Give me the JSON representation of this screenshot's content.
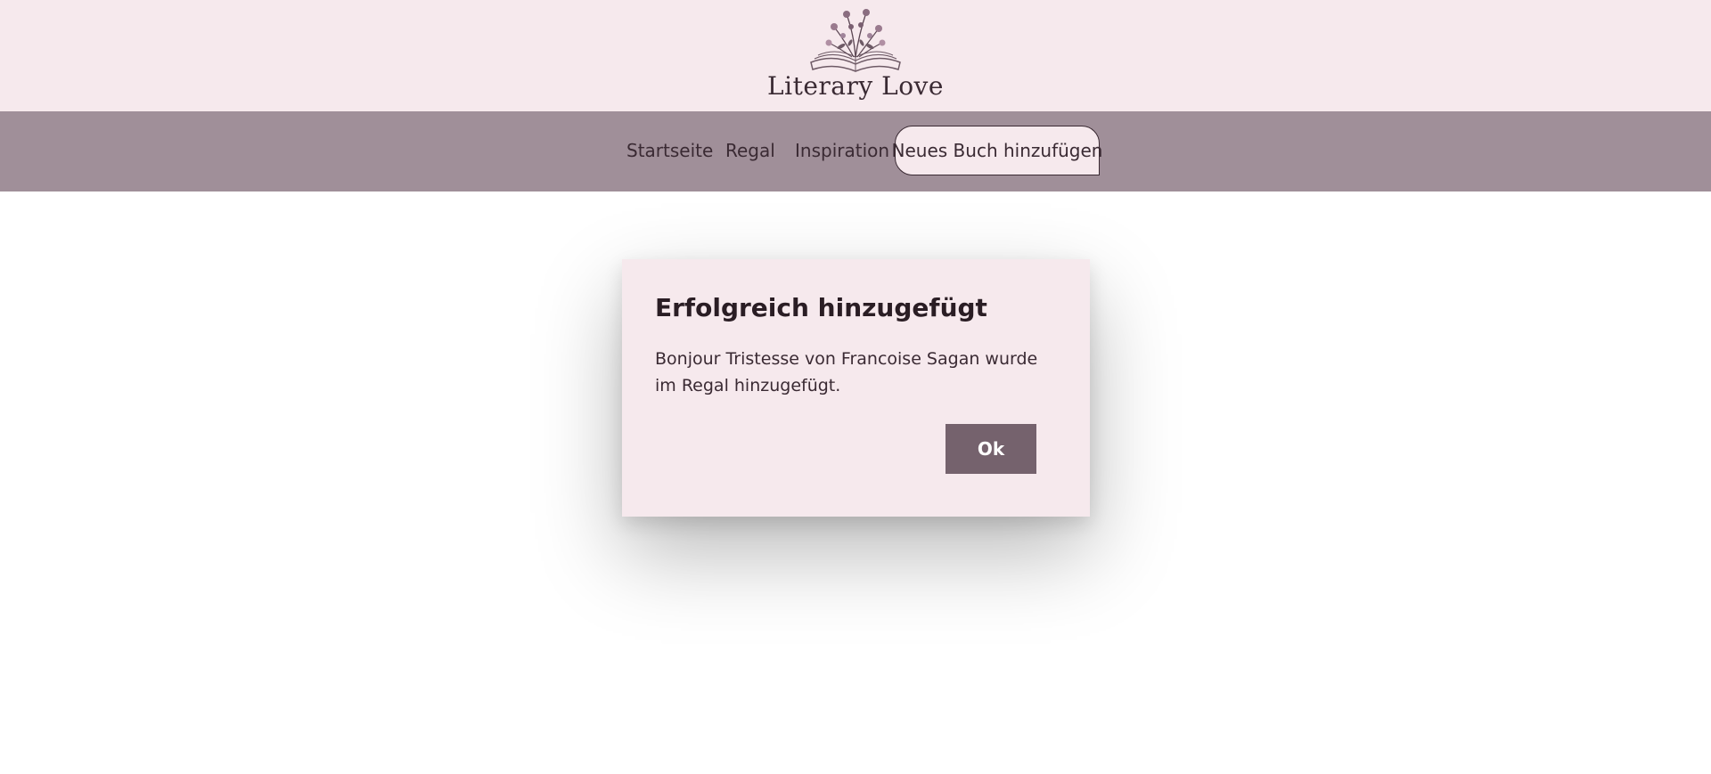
{
  "brand": {
    "name": "Literary Love",
    "logo_icon": "open-book-flowers-icon"
  },
  "nav": {
    "items": [
      {
        "label": "Startseite"
      },
      {
        "label": "Regal"
      },
      {
        "label": "Inspiration"
      },
      {
        "label": "Neues Buch hinzufügen",
        "active": true
      }
    ]
  },
  "dialog": {
    "title": "Erfolgreich hinzugefügt",
    "message": "Bonjour Tristesse von Francoise Sagan wurde im Regal hinzugefügt.",
    "ok_label": "Ok"
  },
  "colors": {
    "header_bg": "#f6e9ed",
    "nav_bg": "#a08f99",
    "button_bg": "#75626d",
    "text": "#3a2a33"
  }
}
